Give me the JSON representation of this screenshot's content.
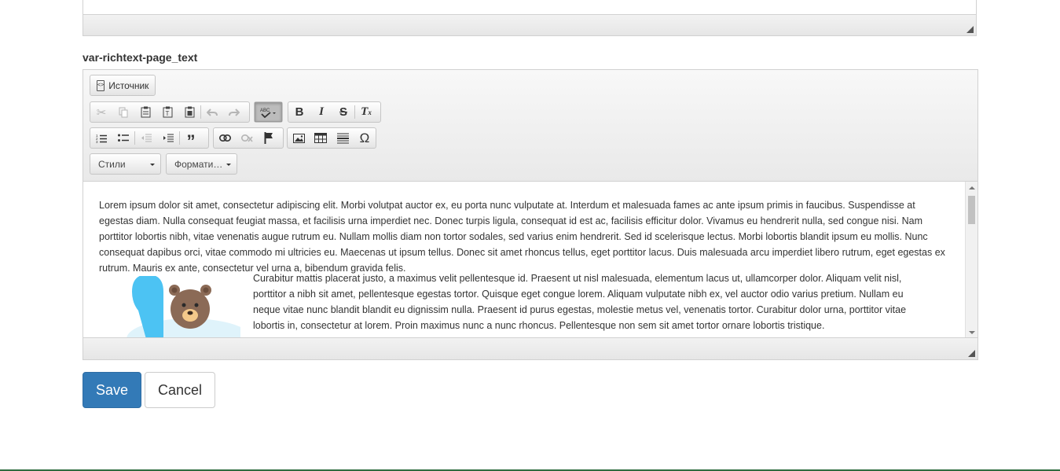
{
  "field": {
    "label": "var-richtext-page_text"
  },
  "toolbar": {
    "source_label": "Источник",
    "styles_label": "Стили",
    "format_label": "Формати…",
    "icons": {
      "cut": "✂",
      "bold": "B",
      "italic": "I",
      "strike": "S",
      "remove_format": "Tx",
      "blockquote": "❞",
      "special_char": "Ω"
    }
  },
  "content": {
    "paragraph1": "Lorem ipsum dolor sit amet, consectetur adipiscing elit. Morbi volutpat auctor ex, eu porta nunc vulputate at. Interdum et malesuada fames ac ante ipsum primis in faucibus. Suspendisse at egestas diam. Nulla consequat feugiat massa, et facilisis urna imperdiet nec. Donec turpis ligula, consequat id est ac, facilisis efficitur dolor. Vivamus eu hendrerit nulla, sed congue nisi. Nam porttitor lobortis nibh, vitae venenatis augue rutrum eu. Nullam mollis diam non tortor sodales, sed varius enim hendrerit. Sed id scelerisque lectus. Morbi lobortis blandit ipsum eu mollis. Nunc consequat dapibus orci, vitae commodo mi ultricies eu. Maecenas ut ipsum tellus. Donec sit amet rhoncus tellus, eget porttitor lacus. Duis malesuada arcu imperdiet libero rutrum, eget egestas ex rutrum. Mauris ex ante, consectetur vel urna a, bibendum gravida felis.",
    "paragraph2": "Curabitur mattis placerat justo, a maximus velit pellentesque id. Praesent ut nisl malesuada, elementum lacus ut, ullamcorper dolor. Aliquam velit nisl, porttitor a nibh sit amet, pellentesque egestas tortor. Quisque eget congue lorem. Aliquam vulputate nibh ex, vel auctor odio varius pretium. Nullam eu neque vitae nunc blandit blandit eu dignissim nulla. Praesent id purus egestas, molestie metus vel, venenatis tortor. Curabitur dolor urna, porttitor vitae lobortis in, consectetur at lorem. Proin maximus nunc a nunc rhoncus. Pellentesque non sem sit amet tortor ornare lobortis tristique."
  },
  "actions": {
    "save_label": "Save",
    "cancel_label": "Cancel"
  },
  "colors": {
    "primary": "#337ab7",
    "bottom_accent": "#2e6b3f"
  }
}
